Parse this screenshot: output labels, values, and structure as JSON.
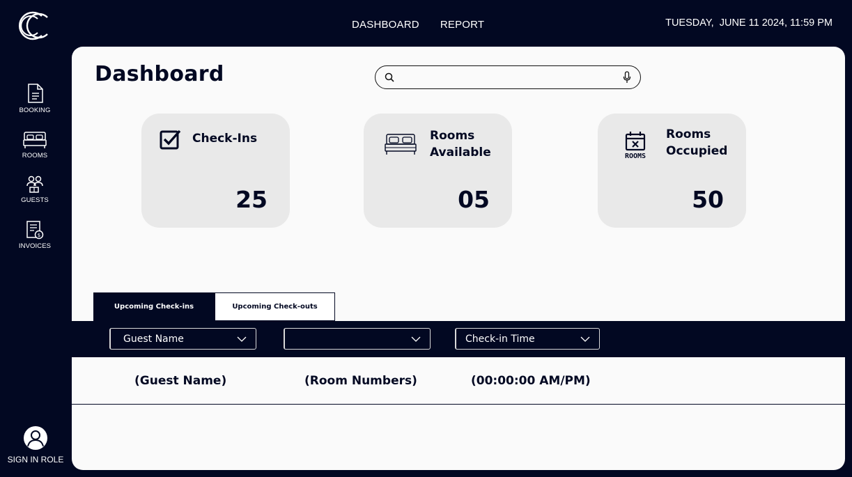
{
  "topnav": {
    "dashboard": "DASHBOARD",
    "report": "REPORT"
  },
  "datetime": "TUESDAY,  JUNE 11 2024, 11:59 PM",
  "sidebar": {
    "items": [
      {
        "label": "BOOKING",
        "icon": "document-icon"
      },
      {
        "label": "ROOMS",
        "icon": "bed-icon"
      },
      {
        "label": "GUESTS",
        "icon": "guests-icon"
      },
      {
        "label": "INVOICES",
        "icon": "invoice-icon"
      }
    ],
    "sign_in": "SIGN IN ROLE"
  },
  "main": {
    "title": "Dashboard",
    "search": {
      "placeholder": ""
    },
    "cards": [
      {
        "title_line1": "Check-Ins",
        "title_line2": "",
        "value": "25",
        "icon": "checkbox-icon"
      },
      {
        "title_line1": "Rooms",
        "title_line2": "Available",
        "value": "05",
        "icon": "bed-icon"
      },
      {
        "title_line1": "Rooms",
        "title_line2": "Occupied",
        "value": "50",
        "icon": "calendar-rooms-icon",
        "icon_text": "ROOMS"
      }
    ],
    "tabs": [
      {
        "label": "Upcoming Check-ins",
        "active": true
      },
      {
        "label": "Upcoming Check-outs",
        "active": false
      }
    ],
    "filters": [
      {
        "label": "Guest Name"
      },
      {
        "label": ""
      },
      {
        "label": "Check-in Time"
      }
    ],
    "rows": [
      {
        "guest": "(Guest Name)",
        "room": "(Room Numbers)",
        "time": "(00:00:00 AM/PM)"
      }
    ]
  },
  "colors": {
    "navy": "#020822",
    "panel": "#fafafa",
    "card": "#e9e9e9"
  }
}
